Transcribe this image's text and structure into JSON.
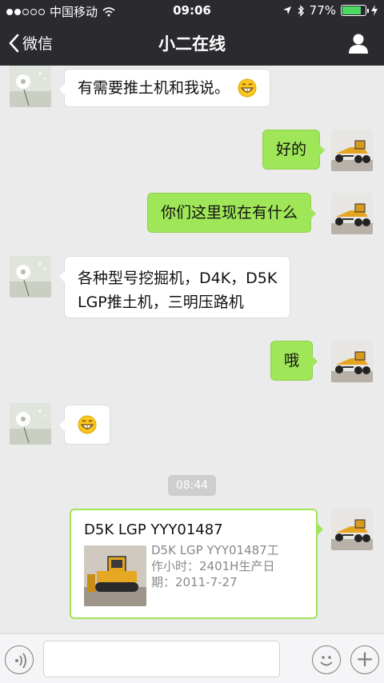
{
  "status_bar": {
    "carrier": "中国移动",
    "time": "09:06",
    "battery": "77%",
    "battery_level": 0.77
  },
  "nav": {
    "back_label": "微信",
    "title": "小二在线"
  },
  "messages": [
    {
      "side": "in",
      "text": "有需要推土机和我说。",
      "has_emoji": true
    },
    {
      "side": "out",
      "text": "好的"
    },
    {
      "side": "out",
      "text": "你们这里现在有什么"
    },
    {
      "side": "in",
      "text_lines": [
        "各种型号挖掘机，D4K，D5K",
        "LGP推土机，三明压路机"
      ]
    },
    {
      "side": "out",
      "text": "哦"
    },
    {
      "side": "in",
      "emoji_only": true
    }
  ],
  "timestamp": "08:44",
  "card": {
    "title": "D5K LGP    YYY01487",
    "desc_lines": [
      "D5K LGP    YYY01487工",
      "作小时：2401H生产日",
      "期：2011-7-27"
    ]
  },
  "input": {
    "value": ""
  },
  "icons": {
    "back": "chevron-left-icon",
    "profile": "person-icon",
    "voice": "voice-icon",
    "emoji": "emoji-icon",
    "plus": "plus-icon"
  },
  "colors": {
    "topbar": "#2b2b2f",
    "outgoing_bubble": "#9fe658",
    "background": "#ebebeb"
  }
}
